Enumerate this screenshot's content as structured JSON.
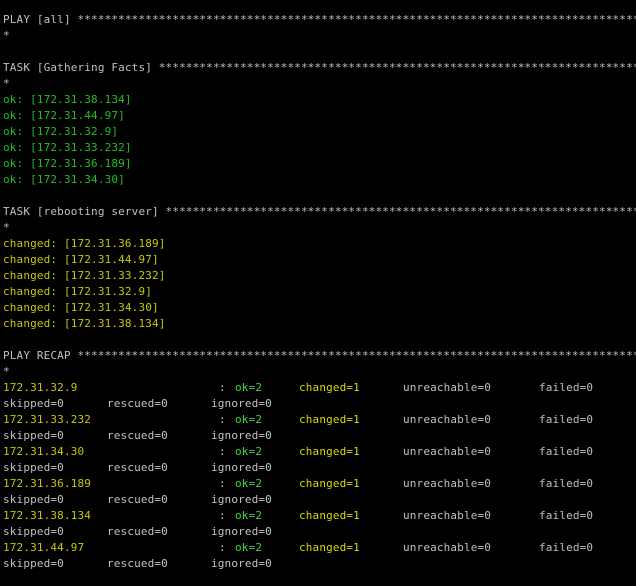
{
  "play_header": "PLAY [all] *********************************************************************************************",
  "star": "*",
  "task1_header": "TASK [Gathering Facts] ****************************************************************************************",
  "task1_results": [
    "ok: [172.31.38.134]",
    "ok: [172.31.44.97]",
    "ok: [172.31.32.9]",
    "ok: [172.31.33.232]",
    "ok: [172.31.36.189]",
    "ok: [172.31.34.30]"
  ],
  "task2_header": "TASK [rebooting server] ***************************************************************************************",
  "task2_results": [
    "changed: [172.31.36.189]",
    "changed: [172.31.44.97]",
    "changed: [172.31.33.232]",
    "changed: [172.31.32.9]",
    "changed: [172.31.34.30]",
    "changed: [172.31.38.134]"
  ],
  "recap_header": "PLAY RECAP ****************************************************************************************************",
  "recap": [
    {
      "host": "172.31.32.9",
      "colon": ":",
      "ok": "ok=2",
      "changed": "changed=1",
      "unreachable": "unreachable=0",
      "failed": "failed=0",
      "skipped": "skipped=0",
      "rescued": "rescued=0",
      "ignored": "ignored=0"
    },
    {
      "host": "172.31.33.232",
      "colon": ":",
      "ok": "ok=2",
      "changed": "changed=1",
      "unreachable": "unreachable=0",
      "failed": "failed=0",
      "skipped": "skipped=0",
      "rescued": "rescued=0",
      "ignored": "ignored=0"
    },
    {
      "host": "172.31.34.30",
      "colon": ":",
      "ok": "ok=2",
      "changed": "changed=1",
      "unreachable": "unreachable=0",
      "failed": "failed=0",
      "skipped": "skipped=0",
      "rescued": "rescued=0",
      "ignored": "ignored=0"
    },
    {
      "host": "172.31.36.189",
      "colon": ":",
      "ok": "ok=2",
      "changed": "changed=1",
      "unreachable": "unreachable=0",
      "failed": "failed=0",
      "skipped": "skipped=0",
      "rescued": "rescued=0",
      "ignored": "ignored=0"
    },
    {
      "host": "172.31.38.134",
      "colon": ":",
      "ok": "ok=2",
      "changed": "changed=1",
      "unreachable": "unreachable=0",
      "failed": "failed=0",
      "skipped": "skipped=0",
      "rescued": "rescued=0",
      "ignored": "ignored=0"
    },
    {
      "host": "172.31.44.97",
      "colon": ":",
      "ok": "ok=2",
      "changed": "changed=1",
      "unreachable": "unreachable=0",
      "failed": "failed=0",
      "skipped": "skipped=0",
      "rescued": "rescued=0",
      "ignored": "ignored=0"
    }
  ],
  "colors": {
    "background": "#000000",
    "default_text": "#c0c0c0",
    "ok": "#1fbf1f",
    "changed": "#c8c800"
  }
}
